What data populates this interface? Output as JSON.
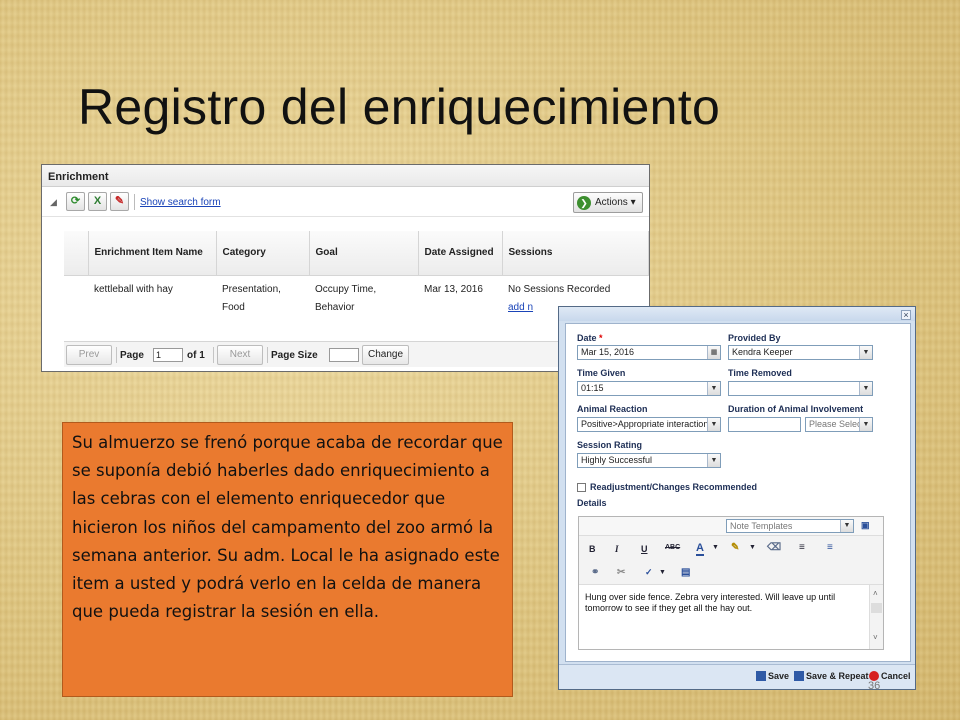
{
  "slide": {
    "title": "Registro del enriquecimiento",
    "number": "36"
  },
  "enrichment": {
    "header": "Enrichment",
    "search_link": "Show search form",
    "actions_label": "Actions",
    "columns": [
      "Enrichment Item Name",
      "Category",
      "Goal",
      "Date Assigned",
      "Sessions"
    ],
    "rows": [
      {
        "item": "kettleball with hay",
        "category": "Presentation, Food",
        "goal": "Occupy Time, Behavior",
        "date": "Mar 13, 2016",
        "sessions": "No Sessions Recorded",
        "add_link": "add n"
      }
    ],
    "pager": {
      "prev": "Prev",
      "page_label": "Page",
      "page_value": "1",
      "of_label": "of 1",
      "next": "Next",
      "page_size_label": "Page Size",
      "page_size_value": "",
      "change": "Change"
    }
  },
  "callout": {
    "text": "Su almuerzo se frenó porque acaba de recordar que se suponía debió haberles dado enriquecimiento a las cebras con el elemento enriquecedor que hicieron los niños del campamento del zoo armó la semana anterior. Su adm. Local le ha asignado este item a usted y podrá verlo en la celda de manera que pueda registrar la sesión en ella."
  },
  "dialog": {
    "date_label": "Date",
    "required_mark": "*",
    "date_value": "Mar 15, 2016",
    "provided_by_label": "Provided By",
    "provided_by_value": "Kendra Keeper",
    "time_given_label": "Time Given",
    "time_given_value": "01:15",
    "time_removed_label": "Time Removed",
    "time_removed_value": "",
    "animal_reaction_label": "Animal Reaction",
    "animal_reaction_value": "Positive>Appropriate interaction",
    "duration_label": "Duration of Animal Involvement",
    "duration_value": "",
    "duration_unit": "Please Select",
    "session_rating_label": "Session Rating",
    "session_rating_value": "Highly Successful",
    "readjustment_label": "Readjustment/Changes Recommended",
    "details_label": "Details",
    "note_templates": "Note Templates",
    "details_text": "Hung over side fence. Zebra very interested. Will leave up until tomorrow to see if they get all the hay out.",
    "save_label": "Save",
    "save_repeat_label": "Save & Repeat",
    "cancel_label": "Cancel"
  },
  "colors": {
    "callout_bg": "#ea7a2f",
    "link": "#1a44b8",
    "dialog_frame": "#d2e0f0",
    "label_blue": "#1d2e55"
  }
}
